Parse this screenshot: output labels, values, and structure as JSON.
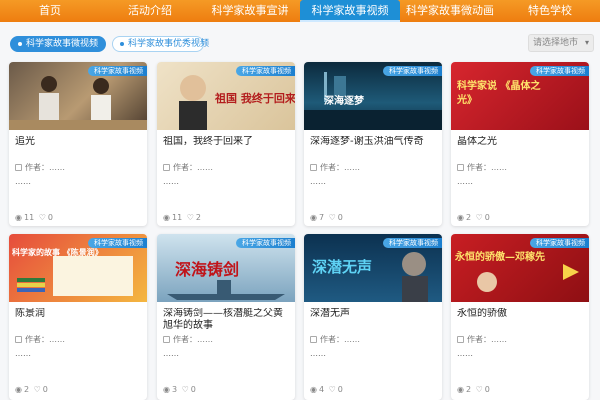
{
  "nav": {
    "items": [
      "首页",
      "活动介绍",
      "科学家故事宣讲",
      "科学家故事视频",
      "科学家故事微动画",
      "特色学校"
    ]
  },
  "tabs": {
    "primary": "科学家故事微视频",
    "secondary": "科学家故事优秀视频"
  },
  "filter": {
    "placeholder": "请选择地市",
    "chevron_icon": "chevron-down-icon"
  },
  "cards": [
    {
      "badge": "科学家故事视频",
      "title": "追光",
      "meta": "作者：……",
      "desc": "……",
      "views": "11",
      "likes": "0",
      "thumb_text": ""
    },
    {
      "badge": "科学家故事视频",
      "title": "祖国，我终于回来了",
      "meta": "作者：……",
      "desc": "……",
      "views": "11",
      "likes": "2",
      "thumb_text": "祖国 我终于回来了"
    },
    {
      "badge": "科学家故事视频",
      "title": "深海逐梦-谢玉洪油气传奇",
      "meta": "作者：……",
      "desc": "……",
      "views": "7",
      "likes": "0",
      "thumb_text": "深海逐梦"
    },
    {
      "badge": "科学家故事视频",
      "title": "晶体之光",
      "meta": "作者：……",
      "desc": "……",
      "views": "2",
      "likes": "0",
      "thumb_text": "科学家说 《晶体之光》"
    },
    {
      "badge": "科学家故事视频",
      "title": "陈景润",
      "meta": "作者：……",
      "desc": "……",
      "views": "2",
      "likes": "0",
      "thumb_text": "科学家的故事 《陈景润》"
    },
    {
      "badge": "科学家故事视频",
      "title": "深海铸剑——核潜艇之父黄旭华的故事",
      "meta": "作者：……",
      "desc": "……",
      "views": "3",
      "likes": "0",
      "thumb_text": "深海铸剑"
    },
    {
      "badge": "科学家故事视频",
      "title": "深潜无声",
      "meta": "作者：……",
      "desc": "……",
      "views": "4",
      "likes": "0",
      "thumb_text": "深潜无声"
    },
    {
      "badge": "科学家故事视频",
      "title": "永恒的骄傲",
      "meta": "作者：……",
      "desc": "……",
      "views": "2",
      "likes": "0",
      "thumb_text": "永恒的骄傲—邓稼先"
    }
  ],
  "icons": {
    "author": "author-icon",
    "views": "eye-icon",
    "likes": "thumb-up-icon"
  },
  "colors": {
    "nav_bg": "#f08a18",
    "nav_active": "#1e8fd6",
    "tab_active": "#2f8fdb",
    "badge": "#2b8ad8"
  }
}
